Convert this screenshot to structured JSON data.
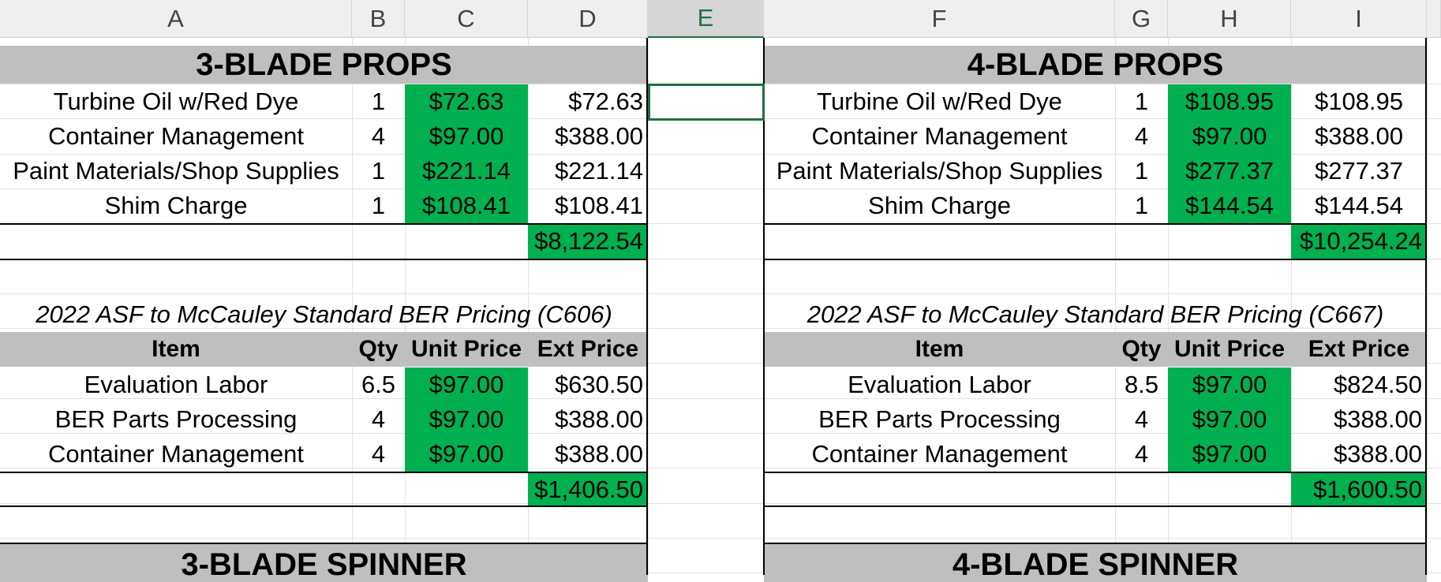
{
  "columns": [
    "A",
    "B",
    "C",
    "D",
    "E",
    "F",
    "G",
    "H",
    "I"
  ],
  "left": {
    "title": "3-BLADE PROPS",
    "items": [
      {
        "item": "Turbine Oil w/Red Dye",
        "qty": "1",
        "unit": "$72.63",
        "ext": "$72.63"
      },
      {
        "item": "Container Management",
        "qty": "4",
        "unit": "$97.00",
        "ext": "$388.00"
      },
      {
        "item": "Paint Materials/Shop Supplies",
        "qty": "1",
        "unit": "$221.14",
        "ext": "$221.14"
      },
      {
        "item": "Shim Charge",
        "qty": "1",
        "unit": "$108.41",
        "ext": "$108.41"
      }
    ],
    "total": "$8,122.54",
    "ber_title": "2022 ASF to McCauley Standard BER Pricing (C606)",
    "headers": {
      "item": "Item",
      "qty": "Qty",
      "unit": "Unit Price",
      "ext": "Ext Price"
    },
    "ber_items": [
      {
        "item": "Evaluation Labor",
        "qty": "6.5",
        "unit": "$97.00",
        "ext": "$630.50"
      },
      {
        "item": "BER Parts Processing",
        "qty": "4",
        "unit": "$97.00",
        "ext": "$388.00"
      },
      {
        "item": "Container Management",
        "qty": "4",
        "unit": "$97.00",
        "ext": "$388.00"
      }
    ],
    "ber_total": "$1,406.50",
    "spinner_title": "3-BLADE SPINNER"
  },
  "right": {
    "title": "4-BLADE PROPS",
    "items": [
      {
        "item": "Turbine Oil w/Red Dye",
        "qty": "1",
        "unit": "$108.95",
        "ext": "$108.95"
      },
      {
        "item": "Container Management",
        "qty": "4",
        "unit": "$97.00",
        "ext": "$388.00"
      },
      {
        "item": "Paint Materials/Shop Supplies",
        "qty": "1",
        "unit": "$277.37",
        "ext": "$277.37"
      },
      {
        "item": "Shim Charge",
        "qty": "1",
        "unit": "$144.54",
        "ext": "$144.54"
      }
    ],
    "total": "$10,254.24",
    "ber_title": "2022 ASF to McCauley Standard BER Pricing (C667)",
    "headers": {
      "item": "Item",
      "qty": "Qty",
      "unit": "Unit Price",
      "ext": "Ext Price"
    },
    "ber_items": [
      {
        "item": "Evaluation Labor",
        "qty": "8.5",
        "unit": "$97.00",
        "ext": "$824.50"
      },
      {
        "item": "BER Parts Processing",
        "qty": "4",
        "unit": "$97.00",
        "ext": "$388.00"
      },
      {
        "item": "Container Management",
        "qty": "4",
        "unit": "$97.00",
        "ext": "$388.00"
      }
    ],
    "ber_total": "$1,600.50",
    "spinner_title": "4-BLADE SPINNER"
  },
  "colors": {
    "green": "#00b050",
    "gray": "#bfbfbf",
    "header_bg": "#efefef",
    "selection": "#1f7145"
  }
}
